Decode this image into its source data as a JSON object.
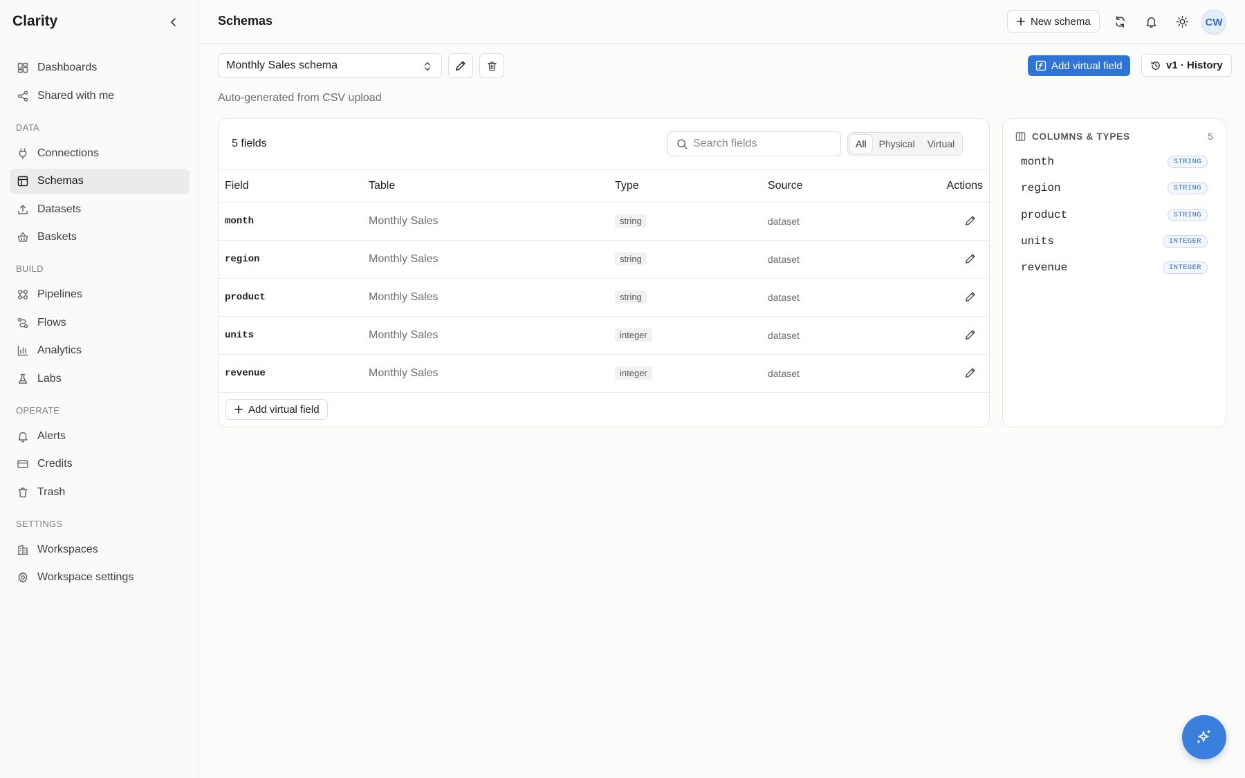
{
  "app": {
    "name": "Clarity"
  },
  "sidebar": {
    "top_items": [
      {
        "label": "Dashboards",
        "icon": "dashboard-icon"
      },
      {
        "label": "Shared with me",
        "icon": "share-icon"
      }
    ],
    "sections": [
      {
        "title": "DATA",
        "items": [
          {
            "label": "Connections",
            "icon": "plug-icon"
          },
          {
            "label": "Schemas",
            "icon": "table-icon",
            "active": true
          },
          {
            "label": "Datasets",
            "icon": "upload-icon"
          },
          {
            "label": "Baskets",
            "icon": "basket-icon"
          }
        ]
      },
      {
        "title": "BUILD",
        "items": [
          {
            "label": "Pipelines",
            "icon": "pipelines-icon"
          },
          {
            "label": "Flows",
            "icon": "flow-icon"
          },
          {
            "label": "Analytics",
            "icon": "bar-chart-icon"
          },
          {
            "label": "Labs",
            "icon": "flask-icon"
          }
        ]
      },
      {
        "title": "OPERATE",
        "items": [
          {
            "label": "Alerts",
            "icon": "bell-icon"
          },
          {
            "label": "Credits",
            "icon": "credit-card-icon"
          },
          {
            "label": "Trash",
            "icon": "trash-icon"
          }
        ]
      },
      {
        "title": "SETTINGS",
        "items": [
          {
            "label": "Workspaces",
            "icon": "building-icon"
          },
          {
            "label": "Workspace settings",
            "icon": "gear-icon"
          }
        ]
      }
    ]
  },
  "header": {
    "title": "Schemas",
    "new_schema_label": "New schema",
    "avatar_initials": "CW"
  },
  "toolbar": {
    "selected_schema": "Monthly Sales schema",
    "add_virtual_field_label": "Add virtual field",
    "history_label": "v1 · History"
  },
  "schema": {
    "description": "Auto-generated from CSV upload"
  },
  "fields_card": {
    "count_label": "5 fields",
    "search_placeholder": "Search fields",
    "filters": [
      "All",
      "Physical",
      "Virtual"
    ],
    "active_filter": "All",
    "columns": [
      "Field",
      "Table",
      "Type",
      "Source",
      "Actions"
    ],
    "rows": [
      {
        "field": "month",
        "table": "Monthly Sales",
        "type": "string",
        "source": "dataset"
      },
      {
        "field": "region",
        "table": "Monthly Sales",
        "type": "string",
        "source": "dataset"
      },
      {
        "field": "product",
        "table": "Monthly Sales",
        "type": "string",
        "source": "dataset"
      },
      {
        "field": "units",
        "table": "Monthly Sales",
        "type": "integer",
        "source": "dataset"
      },
      {
        "field": "revenue",
        "table": "Monthly Sales",
        "type": "integer",
        "source": "dataset"
      }
    ],
    "add_virtual_field_label": "Add virtual field"
  },
  "columns_panel": {
    "title": "COLUMNS & TYPES",
    "count": "5",
    "items": [
      {
        "name": "month",
        "type": "STRING"
      },
      {
        "name": "region",
        "type": "STRING"
      },
      {
        "name": "product",
        "type": "STRING"
      },
      {
        "name": "units",
        "type": "INTEGER"
      },
      {
        "name": "revenue",
        "type": "INTEGER"
      }
    ]
  },
  "colors": {
    "accent": "#2d74d6",
    "active_nav_bg": "#ebebea"
  }
}
